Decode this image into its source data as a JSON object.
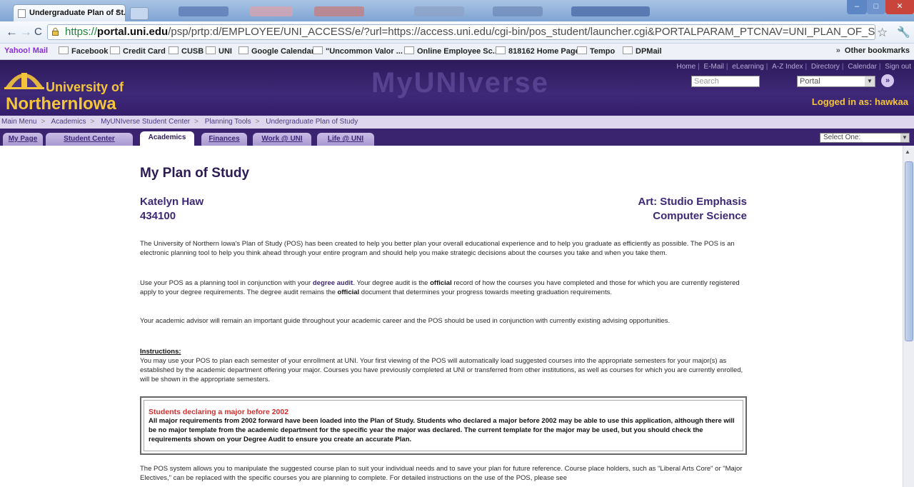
{
  "browser": {
    "tab_title": "Undergraduate Plan of St...",
    "url_scheme": "https://",
    "url_host": "portal.uni.edu",
    "url_rest": "/psp/prtp:d/EMPLOYEE/UNI_ACCESS/e/?url=https://access.uni.edu/cgi-bin/pos_student/launcher.cgi&PORTALPARAM_PTCNAV=UNI_PLAN_OF_STUDY&EOPP.S",
    "bookmarks": [
      "Yahoo! Mail",
      "Facebook",
      "Credit Card",
      "CUSB",
      "UNI",
      "Google Calendar",
      "\"Uncommon Valor ...",
      "Online Employee Sc...",
      "818162 Home Page",
      "Tempo",
      "DPMail"
    ],
    "other_bookmarks": "Other bookmarks"
  },
  "header": {
    "logo_line1": "University of",
    "logo_line2": "NorthernIowa",
    "banner": "MyUNIverse",
    "top_links": [
      "Home",
      "E-Mail",
      "eLearning",
      "A-Z Index",
      "Directory",
      "Calendar",
      "Sign out"
    ],
    "search_placeholder": "Search",
    "portal_select": "Portal",
    "logged_in": "Logged in as: hawkaa"
  },
  "breadcrumb": [
    "Main Menu",
    "Academics",
    "MyUNIverse Student Center",
    "Planning Tools",
    "Undergraduate Plan of Study"
  ],
  "tabs": [
    {
      "label": "My Page",
      "active": false
    },
    {
      "label": "Student Center",
      "active": false
    },
    {
      "label": "Academics",
      "active": true
    },
    {
      "label": "Finances",
      "active": false
    },
    {
      "label": "Work @ UNI",
      "active": false
    },
    {
      "label": "Life @ UNI",
      "active": false
    }
  ],
  "select_one": "Select One:",
  "content": {
    "title": "My Plan of Study",
    "student_name": "Katelyn Haw",
    "student_id": "434100",
    "major1": "Art: Studio Emphasis",
    "major2": "Computer Science",
    "p1": "The University of Northern Iowa's Plan of Study (POS) has been created to help you better plan your overall educational experience and to help you graduate as efficiently as possible. The POS is an electronic planning tool to help you think ahead through your entire program and should help you make strategic decisions about the courses you take and when you take them.",
    "p2_pre": "Use your POS as a planning tool in conjunction with your ",
    "p2_link": "degree audit",
    "p2_mid1": ". Your degree audit is the ",
    "p2_bold1": "official",
    "p2_mid2": " record of how the courses you have completed and those for which you are currently registered apply to your degree requirements. The degree audit remains the ",
    "p2_bold2": "official",
    "p2_post": " document that determines your progress towards meeting graduation requirements.",
    "p3": "Your academic advisor will remain an important guide throughout your academic career and the POS should be used in conjunction with currently existing advising opportunities.",
    "instructions_head": "Instructions:",
    "instructions_body": "You may use your POS to plan each semester of your enrollment at UNI. Your first viewing of the POS will automatically load suggested courses into the appropriate semesters for your major(s) as established by the academic department offering your major. Courses you have previously completed at UNI or transferred from other institutions, as well as courses for which you are currently enrolled, will be shown in the appropriate semesters.",
    "notice_title": "Students declaring a major before 2002",
    "notice_body": "All major requirements from 2002 forward have been loaded into the Plan of Study. Students who declared a major before 2002 may be able to use this application, although there will be no major template from the academic department for the specific year the major was declared. The current template for the major may be used, but you should check the requirements shown on your Degree Audit to ensure you create an accurate Plan.",
    "p_last": "The POS system allows you to manipulate the suggested course plan to suit your individual needs and to save your plan for future reference. Course place holders, such as \"Liberal Arts Core\" or \"Major Electives,\" can be replaced with the specific courses you are planning to complete. For detailed instructions on the use of the POS, please see"
  }
}
